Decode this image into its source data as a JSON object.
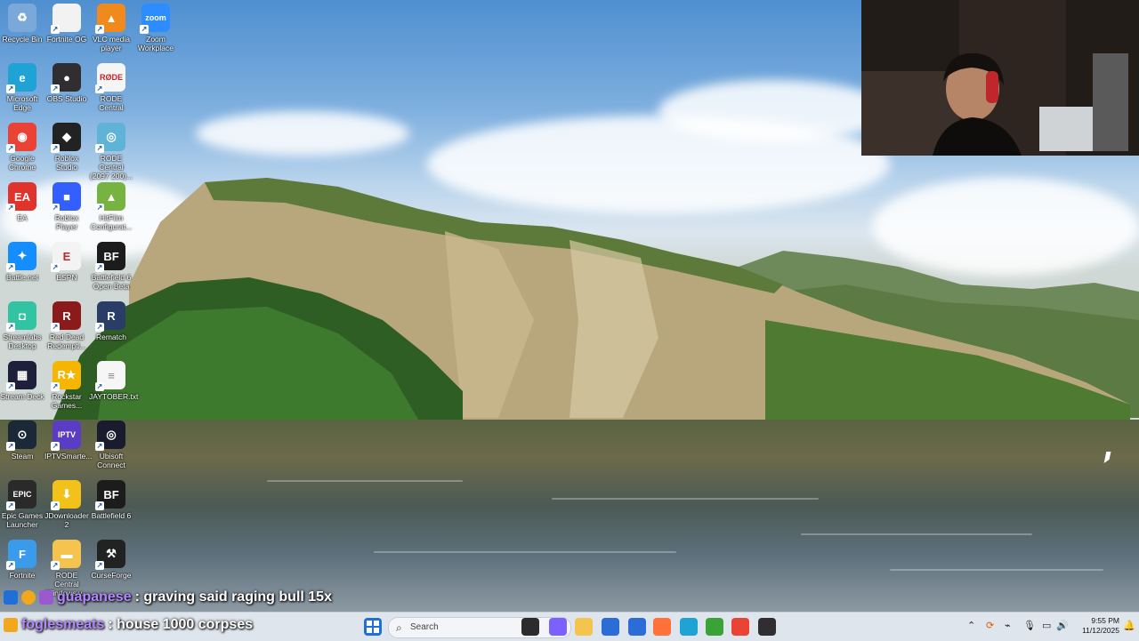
{
  "desktop_icons": [
    {
      "label": "Recycle Bin",
      "icon": "recycle-bin-icon",
      "color": "#7aa8d8"
    },
    {
      "label": "Fortnite OG",
      "icon": "document-icon",
      "color": "#f2f2f2"
    },
    {
      "label": "VLC media player",
      "icon": "vlc-icon",
      "color": "#f08a1d"
    },
    {
      "label": "Zoom Workplace",
      "icon": "zoom-icon",
      "color": "#2d8cff"
    },
    {
      "label": "Microsoft Edge",
      "icon": "edge-icon",
      "color": "#1fa2d4"
    },
    {
      "label": "OBS Studio",
      "icon": "obs-icon",
      "color": "#302e31"
    },
    {
      "label": "RODE Central",
      "icon": "rode-icon",
      "color": "#f5f5f5"
    },
    {
      "label": "Google Chrome",
      "icon": "chrome-icon",
      "color": "#ea4335"
    },
    {
      "label": "Roblox Studio",
      "icon": "roblox-studio-icon",
      "color": "#222222"
    },
    {
      "label": "RODE Central (2097 200)...",
      "icon": "installer-icon",
      "color": "#5fb3d6"
    },
    {
      "label": "EA",
      "icon": "ea-icon",
      "color": "#e0332c"
    },
    {
      "label": "Roblox Player",
      "icon": "roblox-icon",
      "color": "#335fff"
    },
    {
      "label": "HitFilm Configurat...",
      "icon": "android-icon",
      "color": "#77b341"
    },
    {
      "label": "Battle.net",
      "icon": "battlenet-icon",
      "color": "#148eff"
    },
    {
      "label": "ESPN",
      "icon": "espn-icon",
      "color": "#f3f3f3"
    },
    {
      "label": "Battlefield 6 Open Beta",
      "icon": "battlefield-icon",
      "color": "#1c1c1c"
    },
    {
      "label": "Streamlabs Desktop",
      "icon": "streamlabs-icon",
      "color": "#31c3a2"
    },
    {
      "label": "Red Dead Redempti...",
      "icon": "rdr-icon",
      "color": "#8b1b1b"
    },
    {
      "label": "Rematch",
      "icon": "rematch-icon",
      "color": "#2a3d66"
    },
    {
      "label": "Stream Deck",
      "icon": "streamdeck-icon",
      "color": "#1e1f3a"
    },
    {
      "label": "Rockstar Games...",
      "icon": "rockstar-icon",
      "color": "#f6b500"
    },
    {
      "label": "JAYTOBER.txt",
      "icon": "text-file-icon",
      "color": "#f6f6f6"
    },
    {
      "label": "Steam",
      "icon": "steam-icon",
      "color": "#1b2838"
    },
    {
      "label": "IPTVSmarte...",
      "icon": "iptv-icon",
      "color": "#5b3cc4"
    },
    {
      "label": "Ubisoft Connect",
      "icon": "ubisoft-icon",
      "color": "#1b1b2f"
    },
    {
      "label": "Epic Games Launcher",
      "icon": "epic-icon",
      "color": "#2a2a2a"
    },
    {
      "label": "JDownloader 2",
      "icon": "jdownloader-icon",
      "color": "#f2c21b"
    },
    {
      "label": "Battlefield 6",
      "icon": "battlefield-icon",
      "color": "#1c1c1c"
    },
    {
      "label": "Fortnite",
      "icon": "fortnite-icon",
      "color": "#3a9bea"
    },
    {
      "label": "RODE Central Windows v...",
      "icon": "folder-icon",
      "color": "#f4c44e"
    },
    {
      "label": "CurseForge",
      "icon": "curseforge-icon",
      "color": "#222222"
    }
  ],
  "icon_glyphs": {
    "recycle-bin-icon": "♻",
    "document-icon": "",
    "vlc-icon": "▲",
    "zoom-icon": "zoom",
    "edge-icon": "e",
    "obs-icon": "●",
    "rode-icon": "RØDE",
    "chrome-icon": "◉",
    "roblox-studio-icon": "◆",
    "installer-icon": "◎",
    "ea-icon": "EA",
    "roblox-icon": "■",
    "android-icon": "▲",
    "battlenet-icon": "✦",
    "espn-icon": "E",
    "battlefield-icon": "BF",
    "streamlabs-icon": "◘",
    "rdr-icon": "R",
    "rematch-icon": "R",
    "streamdeck-icon": "▦",
    "rockstar-icon": "R★",
    "text-file-icon": "≡",
    "steam-icon": "⊙",
    "iptv-icon": "IPTV",
    "ubisoft-icon": "◎",
    "epic-icon": "EPIC",
    "jdownloader-icon": "⬇",
    "fortnite-icon": "F",
    "folder-icon": "▬",
    "curseforge-icon": "⚒"
  },
  "chat": [
    {
      "user": "guapanese",
      "message": ": graving said raging bull 15x"
    },
    {
      "user": "foglesmeats",
      "message": ": house 1000 corpses"
    }
  ],
  "taskbar": {
    "search_placeholder": "Search",
    "pinned": [
      {
        "name": "start-button",
        "color": "#1f6fd6"
      },
      {
        "name": "task-view",
        "color": "#2c2c2c"
      },
      {
        "name": "copilot",
        "color": "#7b61ff"
      },
      {
        "name": "file-explorer",
        "color": "#f4c44e"
      },
      {
        "name": "microsoft-store",
        "color": "#2b6cd6"
      },
      {
        "name": "visual-studio",
        "color": "#2b6cd6"
      },
      {
        "name": "firefox",
        "color": "#ff7139"
      },
      {
        "name": "edge",
        "color": "#1fa2d4"
      },
      {
        "name": "xbox",
        "color": "#3aa335"
      },
      {
        "name": "chrome",
        "color": "#ea4335"
      },
      {
        "name": "obs",
        "color": "#302e31"
      }
    ],
    "time": "9:55 PM",
    "date": "11/12/2025"
  }
}
